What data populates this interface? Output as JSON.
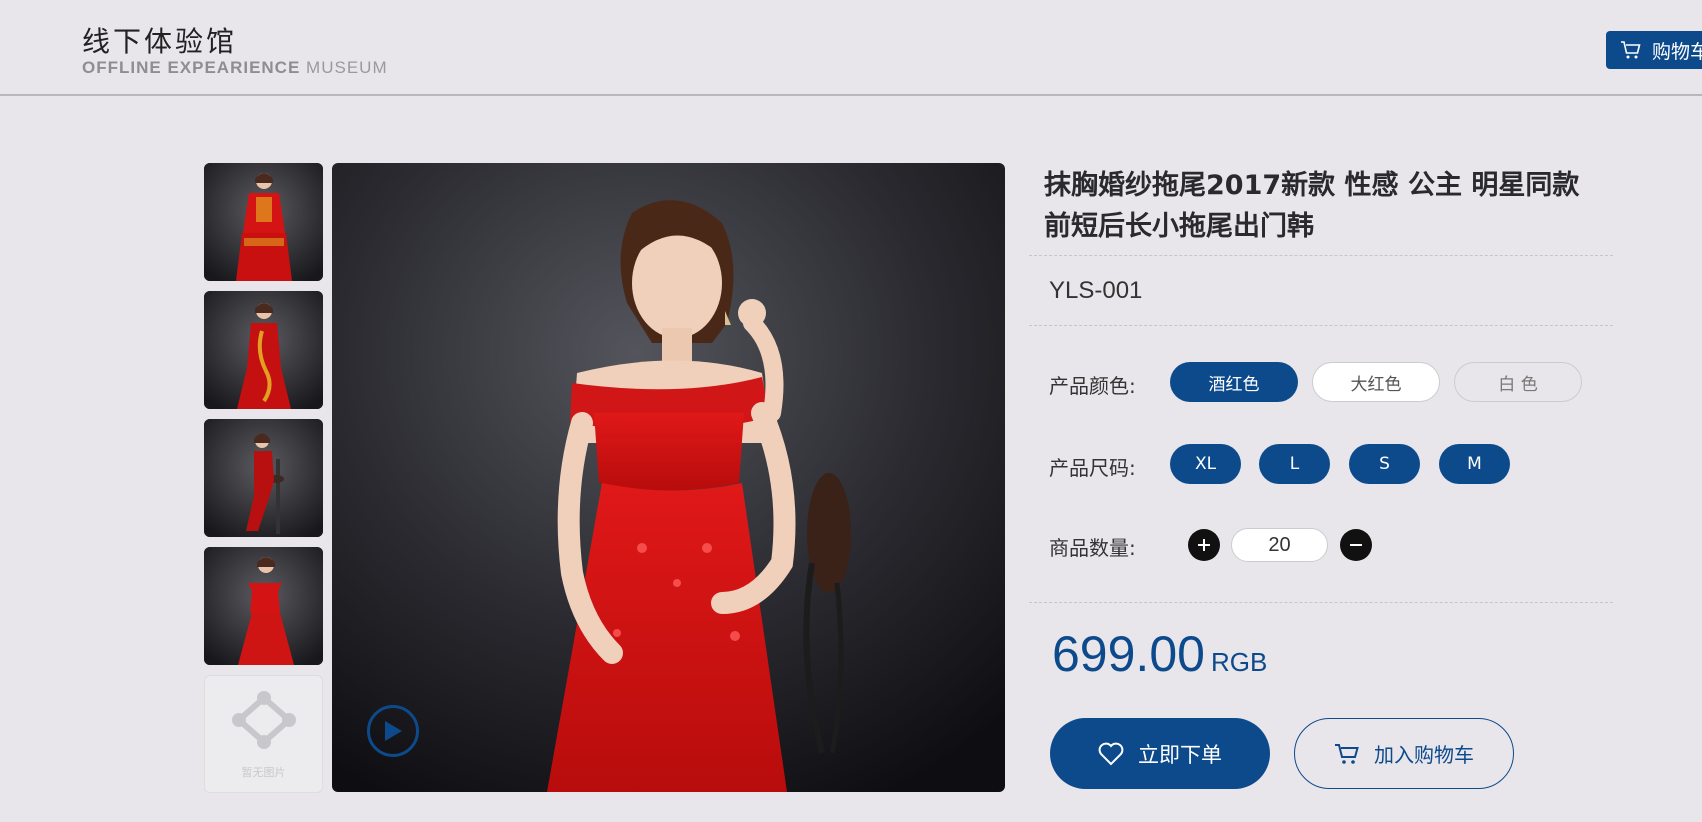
{
  "header": {
    "title": "线下体验馆",
    "subtitle_bold": "OFFLINE EXPEARIENCE",
    "subtitle_light": "MUSEUM",
    "cart_label": "购物车"
  },
  "gallery": {
    "thumbnails": [
      "thumb-qipao-front",
      "thumb-qipao-dragon",
      "thumb-seated",
      "thumb-red-dress"
    ],
    "empty_label": "暂无图片"
  },
  "product": {
    "title": "抹胸婚纱拖尾2017新款 性感 公主 明星同款 前短后长小拖尾出门韩",
    "sku": "YLS-001",
    "color_label": "产品颜色:",
    "colors": [
      "酒红色",
      "大红色",
      "白 色"
    ],
    "selected_color": "酒红色",
    "size_label": "产品尺码:",
    "sizes": [
      "XL",
      "L",
      "S",
      "M"
    ],
    "quantity_label": "商品数量:",
    "quantity": "20",
    "price": "699.00",
    "currency": "RGB",
    "buy_label": "立即下单",
    "add_cart_label": "加入购物车"
  },
  "colors": {
    "accent": "#0d4a8c",
    "background": "#e8e6ea",
    "dress": "#d41414"
  },
  "icons": [
    "cart-icon",
    "play-icon",
    "heart-icon",
    "plus-icon",
    "minus-icon",
    "no-image-icon"
  ]
}
